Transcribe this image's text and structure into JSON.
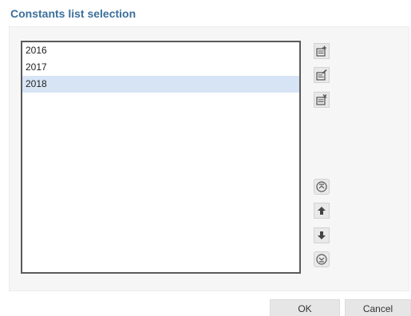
{
  "dialog": {
    "title": "Constants list selection",
    "corner_mark": "⋮"
  },
  "list": {
    "items": [
      {
        "label": "2016",
        "selected": false
      },
      {
        "label": "2017",
        "selected": false
      },
      {
        "label": "2018",
        "selected": true
      }
    ]
  },
  "side_buttons": {
    "top_group": [
      "add-list-icon",
      "edit-list-icon",
      "delete-list-icon"
    ],
    "order_group": [
      "move-to-top-icon",
      "move-up-icon",
      "move-down-icon",
      "move-to-bottom-icon"
    ]
  },
  "footer": {
    "ok_label": "OK",
    "cancel_label": "Cancel"
  },
  "colors": {
    "title": "#3c6f9c",
    "selection": "#d6e4f5",
    "icon": "#555555"
  }
}
